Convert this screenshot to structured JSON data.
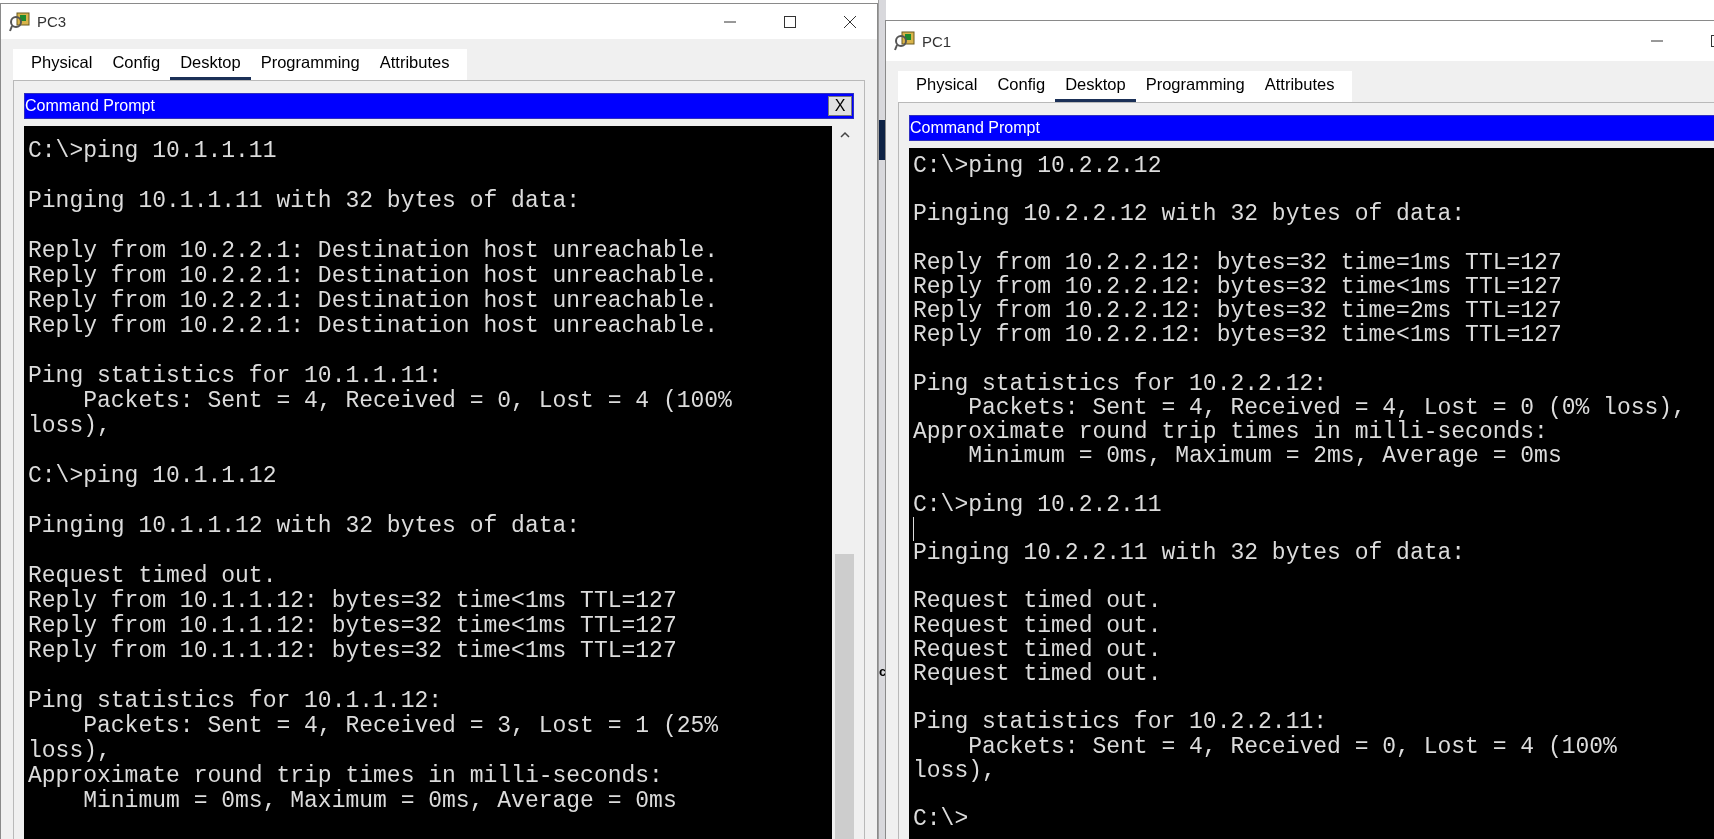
{
  "background_text": "c",
  "windows": [
    {
      "title": "PC3",
      "title_buttons": [
        {
          "kind": "minimize"
        },
        {
          "kind": "maximize"
        },
        {
          "kind": "close"
        }
      ],
      "tabs": [
        {
          "label": "Physical",
          "selected": false
        },
        {
          "label": "Config",
          "selected": false
        },
        {
          "label": "Desktop",
          "selected": true
        },
        {
          "label": "Programming",
          "selected": false
        },
        {
          "label": "Attributes",
          "selected": false
        }
      ],
      "app_title": "Command Prompt",
      "app_close": "X",
      "scrollbar": true,
      "lines": [
        {
          "kind": "text",
          "text": "C:\\>ping 10.1.1.11"
        },
        {
          "kind": "blank"
        },
        {
          "kind": "text",
          "text": "Pinging 10.1.1.11 with 32 bytes of data:"
        },
        {
          "kind": "blank"
        },
        {
          "kind": "text",
          "text": "Reply from 10.2.2.1: Destination host unreachable."
        },
        {
          "kind": "text",
          "text": "Reply from 10.2.2.1: Destination host unreachable."
        },
        {
          "kind": "text",
          "text": "Reply from 10.2.2.1: Destination host unreachable."
        },
        {
          "kind": "text",
          "text": "Reply from 10.2.2.1: Destination host unreachable."
        },
        {
          "kind": "blank"
        },
        {
          "kind": "text",
          "text": "Ping statistics for 10.1.1.11:"
        },
        {
          "kind": "text",
          "text": "    Packets: Sent = 4, Received = 0, Lost = 4 (100%"
        },
        {
          "kind": "text",
          "text": "loss),"
        },
        {
          "kind": "blank"
        },
        {
          "kind": "text",
          "text": "C:\\>ping 10.1.1.12"
        },
        {
          "kind": "blank"
        },
        {
          "kind": "text",
          "text": "Pinging 10.1.1.12 with 32 bytes of data:"
        },
        {
          "kind": "blank"
        },
        {
          "kind": "text",
          "text": "Request timed out."
        },
        {
          "kind": "text",
          "text": "Reply from 10.1.1.12: bytes=32 time<1ms TTL=127"
        },
        {
          "kind": "text",
          "text": "Reply from 10.1.1.12: bytes=32 time<1ms TTL=127"
        },
        {
          "kind": "text",
          "text": "Reply from 10.1.1.12: bytes=32 time<1ms TTL=127"
        },
        {
          "kind": "blank"
        },
        {
          "kind": "text",
          "text": "Ping statistics for 10.1.1.12:"
        },
        {
          "kind": "text",
          "text": "    Packets: Sent = 4, Received = 3, Lost = 1 (25%"
        },
        {
          "kind": "text",
          "text": "loss),"
        },
        {
          "kind": "text",
          "text": "Approximate round trip times in milli-seconds:"
        },
        {
          "kind": "text",
          "text": "    Minimum = 0ms, Maximum = 0ms, Average = 0ms"
        }
      ]
    },
    {
      "title": "PC1",
      "title_buttons": [
        {
          "kind": "minimize"
        },
        {
          "kind": "maximize"
        }
      ],
      "tabs": [
        {
          "label": "Physical",
          "selected": false
        },
        {
          "label": "Config",
          "selected": false
        },
        {
          "label": "Desktop",
          "selected": true
        },
        {
          "label": "Programming",
          "selected": false
        },
        {
          "label": "Attributes",
          "selected": false
        }
      ],
      "app_title": "Command Prompt",
      "scrollbar": false,
      "lines": [
        {
          "kind": "text",
          "text": "C:\\>ping 10.2.2.12"
        },
        {
          "kind": "blank"
        },
        {
          "kind": "text",
          "text": "Pinging 10.2.2.12 with 32 bytes of data:"
        },
        {
          "kind": "blank"
        },
        {
          "kind": "text",
          "text": "Reply from 10.2.2.12: bytes=32 time=1ms TTL=127"
        },
        {
          "kind": "text",
          "text": "Reply from 10.2.2.12: bytes=32 time<1ms TTL=127"
        },
        {
          "kind": "text",
          "text": "Reply from 10.2.2.12: bytes=32 time=2ms TTL=127"
        },
        {
          "kind": "text",
          "text": "Reply from 10.2.2.12: bytes=32 time<1ms TTL=127"
        },
        {
          "kind": "blank"
        },
        {
          "kind": "text",
          "text": "Ping statistics for 10.2.2.12:"
        },
        {
          "kind": "text",
          "text": "    Packets: Sent = 4, Received = 4, Lost = 0 (0% loss),"
        },
        {
          "kind": "text",
          "text": "Approximate round trip times in milli-seconds:"
        },
        {
          "kind": "text",
          "text": "    Minimum = 0ms, Maximum = 2ms, Average = 0ms"
        },
        {
          "kind": "blank"
        },
        {
          "kind": "text",
          "text": "C:\\>ping 10.2.2.11"
        },
        {
          "kind": "cursor"
        },
        {
          "kind": "text",
          "text": "Pinging 10.2.2.11 with 32 bytes of data:"
        },
        {
          "kind": "blank"
        },
        {
          "kind": "text",
          "text": "Request timed out."
        },
        {
          "kind": "text",
          "text": "Request timed out."
        },
        {
          "kind": "text",
          "text": "Request timed out."
        },
        {
          "kind": "text",
          "text": "Request timed out."
        },
        {
          "kind": "blank"
        },
        {
          "kind": "text",
          "text": "Ping statistics for 10.2.2.11:"
        },
        {
          "kind": "text",
          "text": "    Packets: Sent = 4, Received = 0, Lost = 4 (100%"
        },
        {
          "kind": "text",
          "text": "loss),"
        },
        {
          "kind": "blank"
        },
        {
          "kind": "text",
          "text": "C:\\>"
        }
      ]
    }
  ]
}
